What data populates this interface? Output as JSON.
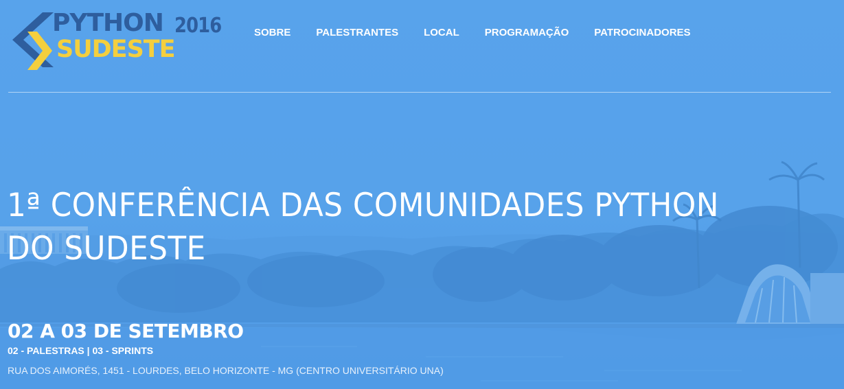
{
  "logo": {
    "line1": "PYTHON",
    "year": "2016",
    "line2": "SUDESTE",
    "colors": {
      "blue": "#2e5e9e",
      "yellow": "#f4cf3e"
    }
  },
  "nav": {
    "items": [
      {
        "label": "SOBRE"
      },
      {
        "label": "PALESTRANTES"
      },
      {
        "label": "LOCAL"
      },
      {
        "label": "PROGRAMAÇÃO"
      },
      {
        "label": "PATROCINADORES"
      }
    ]
  },
  "hero": {
    "title_line1": "1ª CONFERÊNCIA DAS COMUNIDADES PYTHON",
    "title_line2": "DO SUDESTE",
    "date": "02 A 03 DE SETEMBRO",
    "schedule": "02 - PALESTRAS | 03 - SPRINTS",
    "address": "RUA DOS AIMORÉS, 1451 - LOURDES, BELO HORIZONTE - MG (CENTRO UNIVERSITÁRIO UNA)",
    "background_overlay_color": "#58a3ec"
  }
}
